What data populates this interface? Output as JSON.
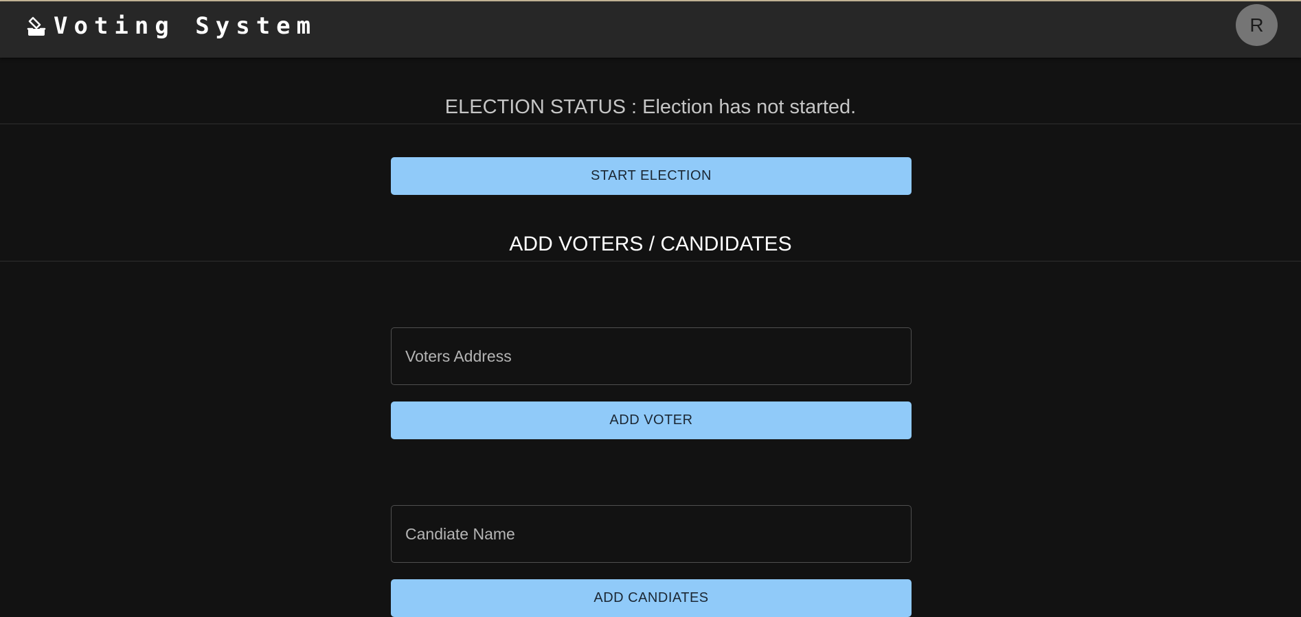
{
  "app": {
    "title": "Voting System",
    "avatar_initial": "R"
  },
  "election": {
    "status_text": "ELECTION STATUS : Election has not started.",
    "start_button_label": "START ELECTION"
  },
  "add_section": {
    "title": "ADD VOTERS / CANDIDATES",
    "voter": {
      "placeholder": "Voters Address",
      "value": "",
      "button_label": "ADD VOTER"
    },
    "candidate": {
      "placeholder": "Candiate Name",
      "value": "",
      "button_label": "ADD CANDIATES"
    }
  },
  "colors": {
    "background": "#121212",
    "appbar": "#272727",
    "button": "#90caf9",
    "avatar": "#757575"
  },
  "icons": {
    "brand": "ballot-box-icon"
  }
}
